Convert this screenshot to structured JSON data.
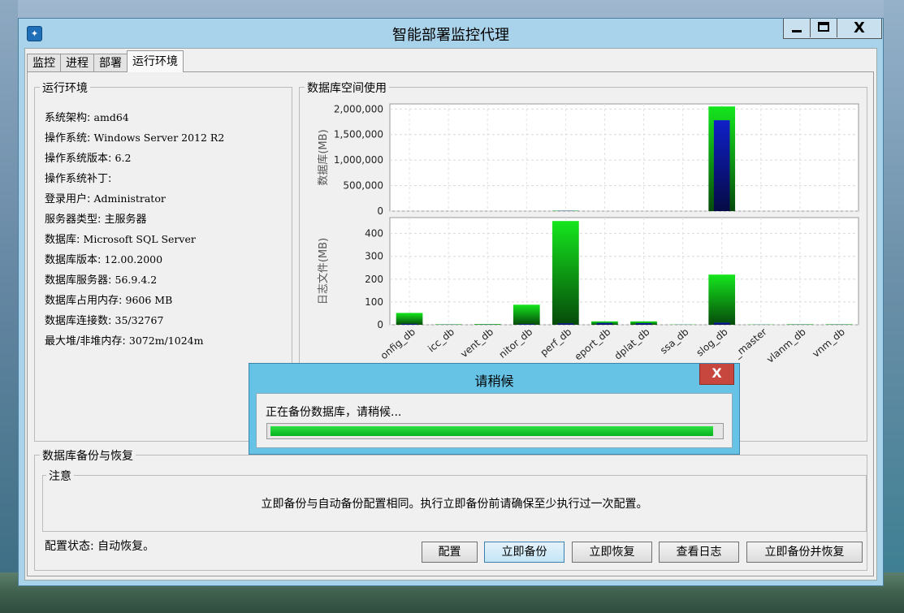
{
  "window": {
    "title": "智能部署监控代理",
    "app_icon": "app-icon",
    "controls": [
      "minimize-icon",
      "maximize-icon",
      "close-icon"
    ],
    "close_glyph": "X"
  },
  "tabs": [
    {
      "label": "监控",
      "active": false
    },
    {
      "label": "进程",
      "active": false
    },
    {
      "label": "部署",
      "active": false
    },
    {
      "label": "运行环境",
      "active": true
    }
  ],
  "env": {
    "title": "运行环境",
    "rows": [
      {
        "key": "系统架构: ",
        "value": "amd64"
      },
      {
        "key": "操作系统: ",
        "value": "Windows Server 2012 R2"
      },
      {
        "key": "操作系统版本: ",
        "value": "6.2"
      },
      {
        "key": "操作系统补丁: ",
        "value": ""
      },
      {
        "key": "登录用户: ",
        "value": "Administrator"
      },
      {
        "key": "服务器类型: ",
        "value": "主服务器"
      },
      {
        "key": "数据库: ",
        "value": "Microsoft SQL Server"
      },
      {
        "key": "数据库版本: ",
        "value": "12.00.2000"
      },
      {
        "key": "数据库服务器: ",
        "value": "56.9.4.2"
      },
      {
        "key": "数据库占用内存: ",
        "value": "9606 MB"
      },
      {
        "key": "数据库连接数: ",
        "value": "35/32767"
      },
      {
        "key": "最大堆/非堆内存: ",
        "value": "3072m/1024m"
      }
    ]
  },
  "chart_panel": {
    "title": "数据库空间使用"
  },
  "chart_data": {
    "type": "bar",
    "categories": [
      "config_db",
      "icc_db",
      "event_db",
      "monitor_db",
      "perf_db",
      "report_db",
      "platplat_db",
      "ssa_db",
      "syslog_db",
      "master",
      "vlanm_db",
      "vnm_db"
    ],
    "category_tick_labels": [
      "onfig_db",
      "icc_db",
      "vent_db",
      "nitor_db",
      "perf_db",
      "eport_db",
      "dplat_db",
      "ssa_db",
      "slog_db",
      "_master",
      "vlanm_db",
      "vnm_db"
    ],
    "colors": {
      "allocated": "#15e61d",
      "used": "#1020c8"
    },
    "top": {
      "ylabel": "数据库(MB)",
      "ylim": [
        0,
        2100000
      ],
      "yticks": [
        0,
        500000,
        1000000,
        1500000,
        2000000
      ],
      "ytick_labels": [
        "0",
        "500,000",
        "1,000,000",
        "1,500,000",
        "2,000,000"
      ],
      "series": [
        {
          "values": [
            0,
            0,
            0,
            0,
            8000,
            0,
            0,
            0,
            2050000,
            0,
            0,
            0
          ]
        },
        {
          "values": [
            0,
            0,
            0,
            0,
            5000,
            0,
            0,
            0,
            1780000,
            0,
            0,
            0
          ]
        }
      ]
    },
    "bottom": {
      "ylabel": "日志文件(MB)",
      "ylim": [
        0,
        470
      ],
      "yticks": [
        0,
        100,
        200,
        300,
        400
      ],
      "ytick_labels": [
        "0",
        "100",
        "200",
        "300",
        "400"
      ],
      "series": [
        {
          "values": [
            52,
            2,
            3,
            88,
            455,
            15,
            15,
            1,
            220,
            1,
            2,
            2
          ]
        },
        {
          "values": [
            4,
            0.5,
            0.5,
            3,
            6,
            8,
            7,
            0.5,
            9,
            0.5,
            0.5,
            0.5
          ]
        }
      ]
    }
  },
  "backup": {
    "title": "数据库备份与恢复",
    "notice_title": "注意",
    "notice_text": "立即备份与自动备份配置相同。执行立即备份前请确保至少执行过一次配置。",
    "status_label": "配置状态: ",
    "status_value": "自动恢复。",
    "buttons": {
      "configure": "配置",
      "backup_now": "立即备份",
      "restore_now": "立即恢复",
      "view_log": "查看日志",
      "backup_and_restore": "立即备份并恢复"
    }
  },
  "dialog": {
    "title": "请稍候",
    "close_glyph": "X",
    "message": "正在备份数据库，请稍候...",
    "progress": 0.985
  }
}
